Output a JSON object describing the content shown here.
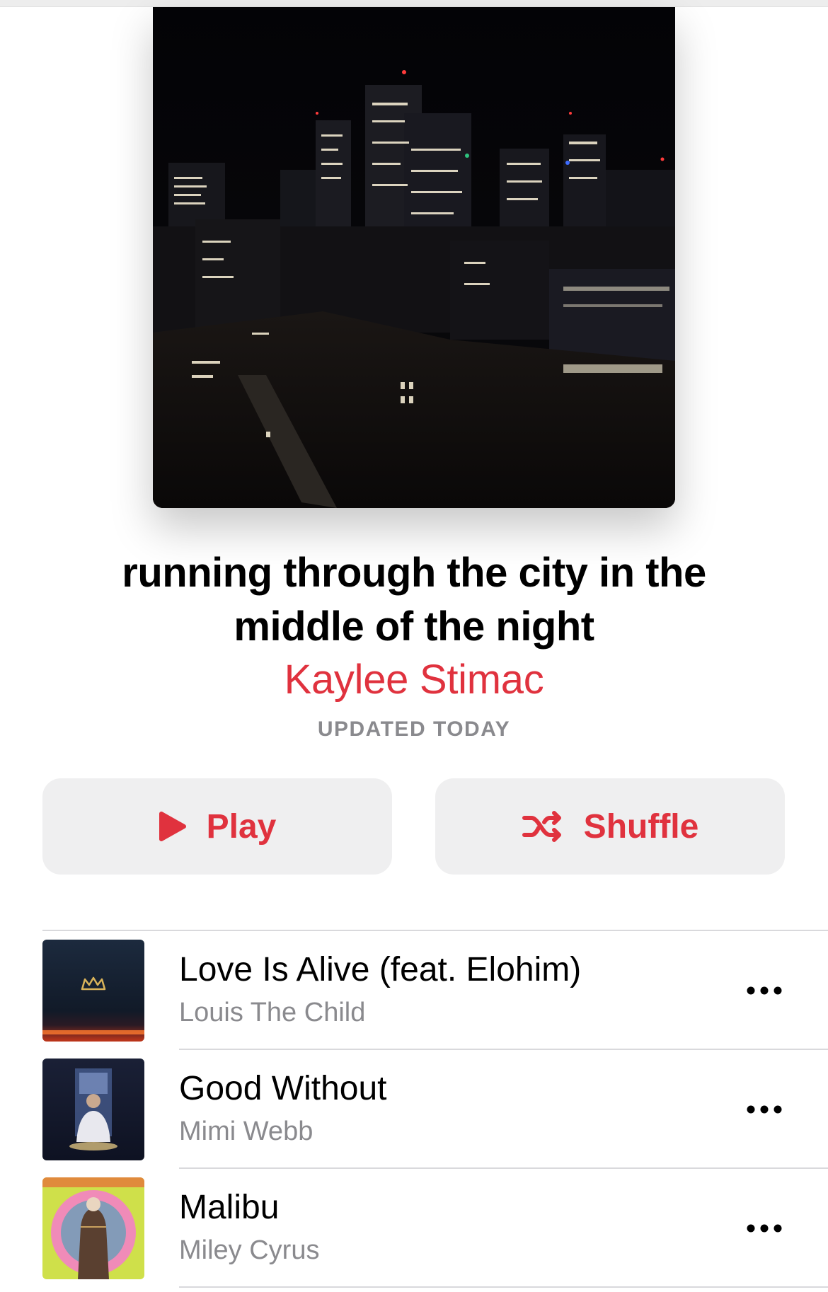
{
  "playlist": {
    "title_line1": "running through the city in the",
    "title_line2": "middle of the night",
    "curator": "Kaylee Stimac",
    "updated": "UPDATED TODAY",
    "artwork_icon": "night-city-skyline"
  },
  "actions": {
    "play_label": "Play",
    "shuffle_label": "Shuffle",
    "play_icon": "play-icon",
    "shuffle_icon": "shuffle-icon"
  },
  "colors": {
    "accent": "#e0323e",
    "button_bg": "#efeff0",
    "secondary_text": "#8a8a8e",
    "divider": "#d9d9dc"
  },
  "tracks": [
    {
      "title": "Love Is Alive (feat. Elohim)",
      "artist": "Louis The Child",
      "artwork_icon": "crown-over-horizon",
      "more_icon": "more-icon"
    },
    {
      "title": "Good Without",
      "artist": "Mimi Webb",
      "artwork_icon": "portrait-album-art",
      "more_icon": "more-icon"
    },
    {
      "title": "Malibu",
      "artist": "Miley Cyrus",
      "artwork_icon": "younger-now-album-art",
      "more_icon": "more-icon"
    }
  ]
}
